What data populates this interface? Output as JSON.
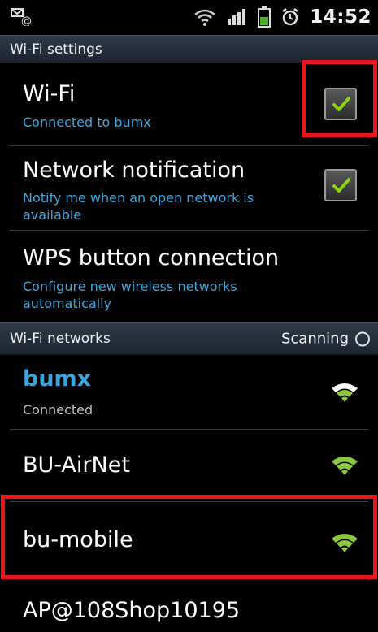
{
  "status_bar": {
    "time": "14:52",
    "icons": [
      "email-notification-icon",
      "wifi-signal-icon",
      "cell-signal-icon",
      "battery-icon",
      "alarm-icon"
    ]
  },
  "wifi_settings": {
    "header": "Wi-Fi settings",
    "wifi": {
      "title": "Wi-Fi",
      "subtitle": "Connected to bumx",
      "checked": true
    },
    "network_notification": {
      "title": "Network notification",
      "subtitle": "Notify me when an open network is available",
      "checked": true
    },
    "wps": {
      "title": "WPS button connection",
      "subtitle": "Configure new wireless networks automatically"
    }
  },
  "wifi_networks": {
    "header": "Wi-Fi networks",
    "scanning_label": "Scanning",
    "networks": [
      {
        "name": "bumx",
        "status": "Connected"
      },
      {
        "name": "BU-AirNet",
        "status": ""
      },
      {
        "name": "bu-mobile",
        "status": ""
      },
      {
        "name": "AP@108Shop10195",
        "status": ""
      }
    ]
  },
  "colors": {
    "accent_blue": "#3aa6dd",
    "check_green": "#8dd316",
    "highlight_red": "#e8151b",
    "wifi_green": "#8dc63f"
  }
}
